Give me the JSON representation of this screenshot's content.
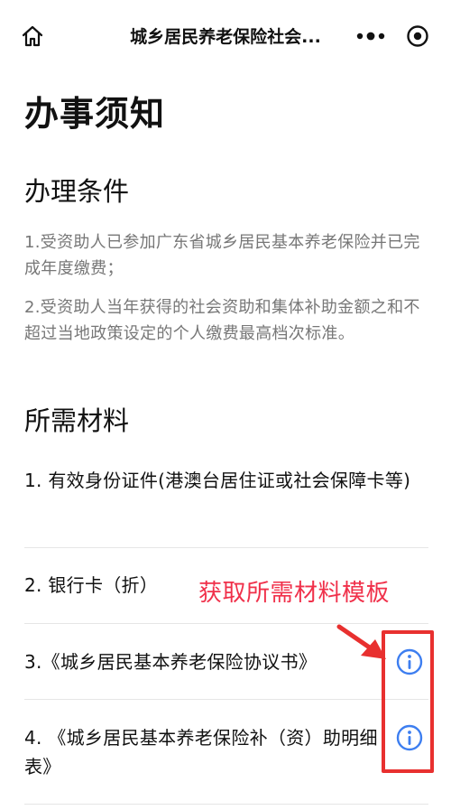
{
  "navbar": {
    "title": "城乡居民养老保险社会...",
    "home_icon": "home-icon",
    "more_icon": "more-dots-icon",
    "close_icon": "mini-program-close-icon"
  },
  "page": {
    "title": "办事须知"
  },
  "conditions": {
    "title": "办理条件",
    "items": [
      "1.受资助人已参加广东省城乡居民基本养老保险并已完成年度缴费；",
      "2.受资助人当年获得的社会资助和集体补助金额之和不超过当地政策设定的个人缴费最高档次标准。"
    ]
  },
  "materials": {
    "title": "所需材料",
    "items": [
      {
        "label": "1. 有效身份证件(港澳台居住证或社会保障卡等)",
        "has_info": false
      },
      {
        "label": "2. 银行卡（折）",
        "has_info": false
      },
      {
        "label": "3.《城乡居民基本养老保险协议书》",
        "has_info": true
      },
      {
        "label": "4. 《城乡居民基本养老保险补（资）助明细表》",
        "has_info": true
      }
    ],
    "info_icon": "info-circle-icon"
  },
  "annotation": {
    "text": "获取所需材料模板",
    "color": "#f0304a"
  },
  "colors": {
    "accent_blue": "#3d7ef0",
    "highlight_red": "#e8302f",
    "muted_text": "#777777"
  }
}
